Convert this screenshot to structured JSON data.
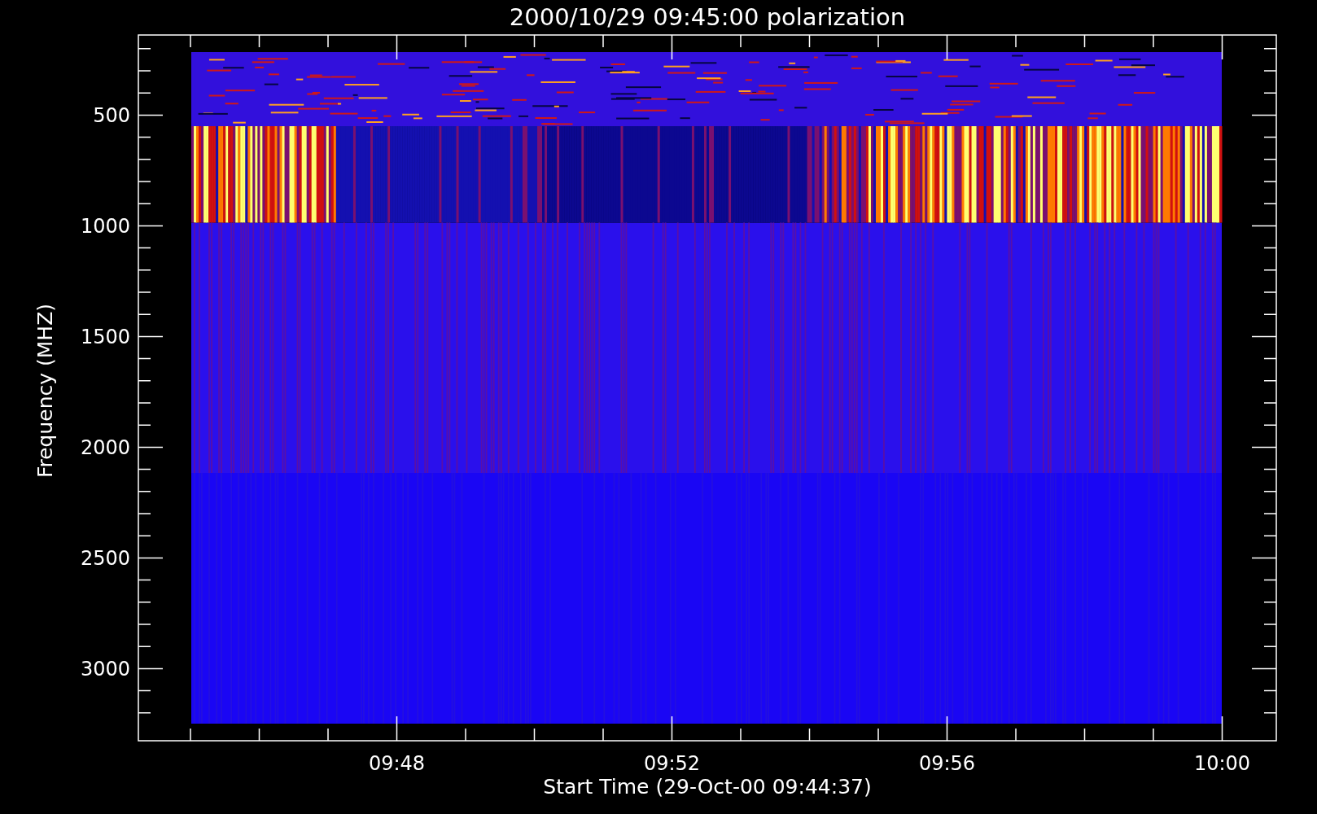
{
  "plot": {
    "title": "2000/10/29 09:45:00 polarization",
    "xlabel": "Start Time (29-Oct-00 09:44:37)",
    "ylabel": "Frequency (MHZ)",
    "xtick_labels": [
      "09:48",
      "09:52",
      "09:56",
      "10:00"
    ],
    "ytick_labels": [
      "500",
      "1000",
      "1500",
      "2000",
      "2500",
      "3000"
    ]
  }
}
